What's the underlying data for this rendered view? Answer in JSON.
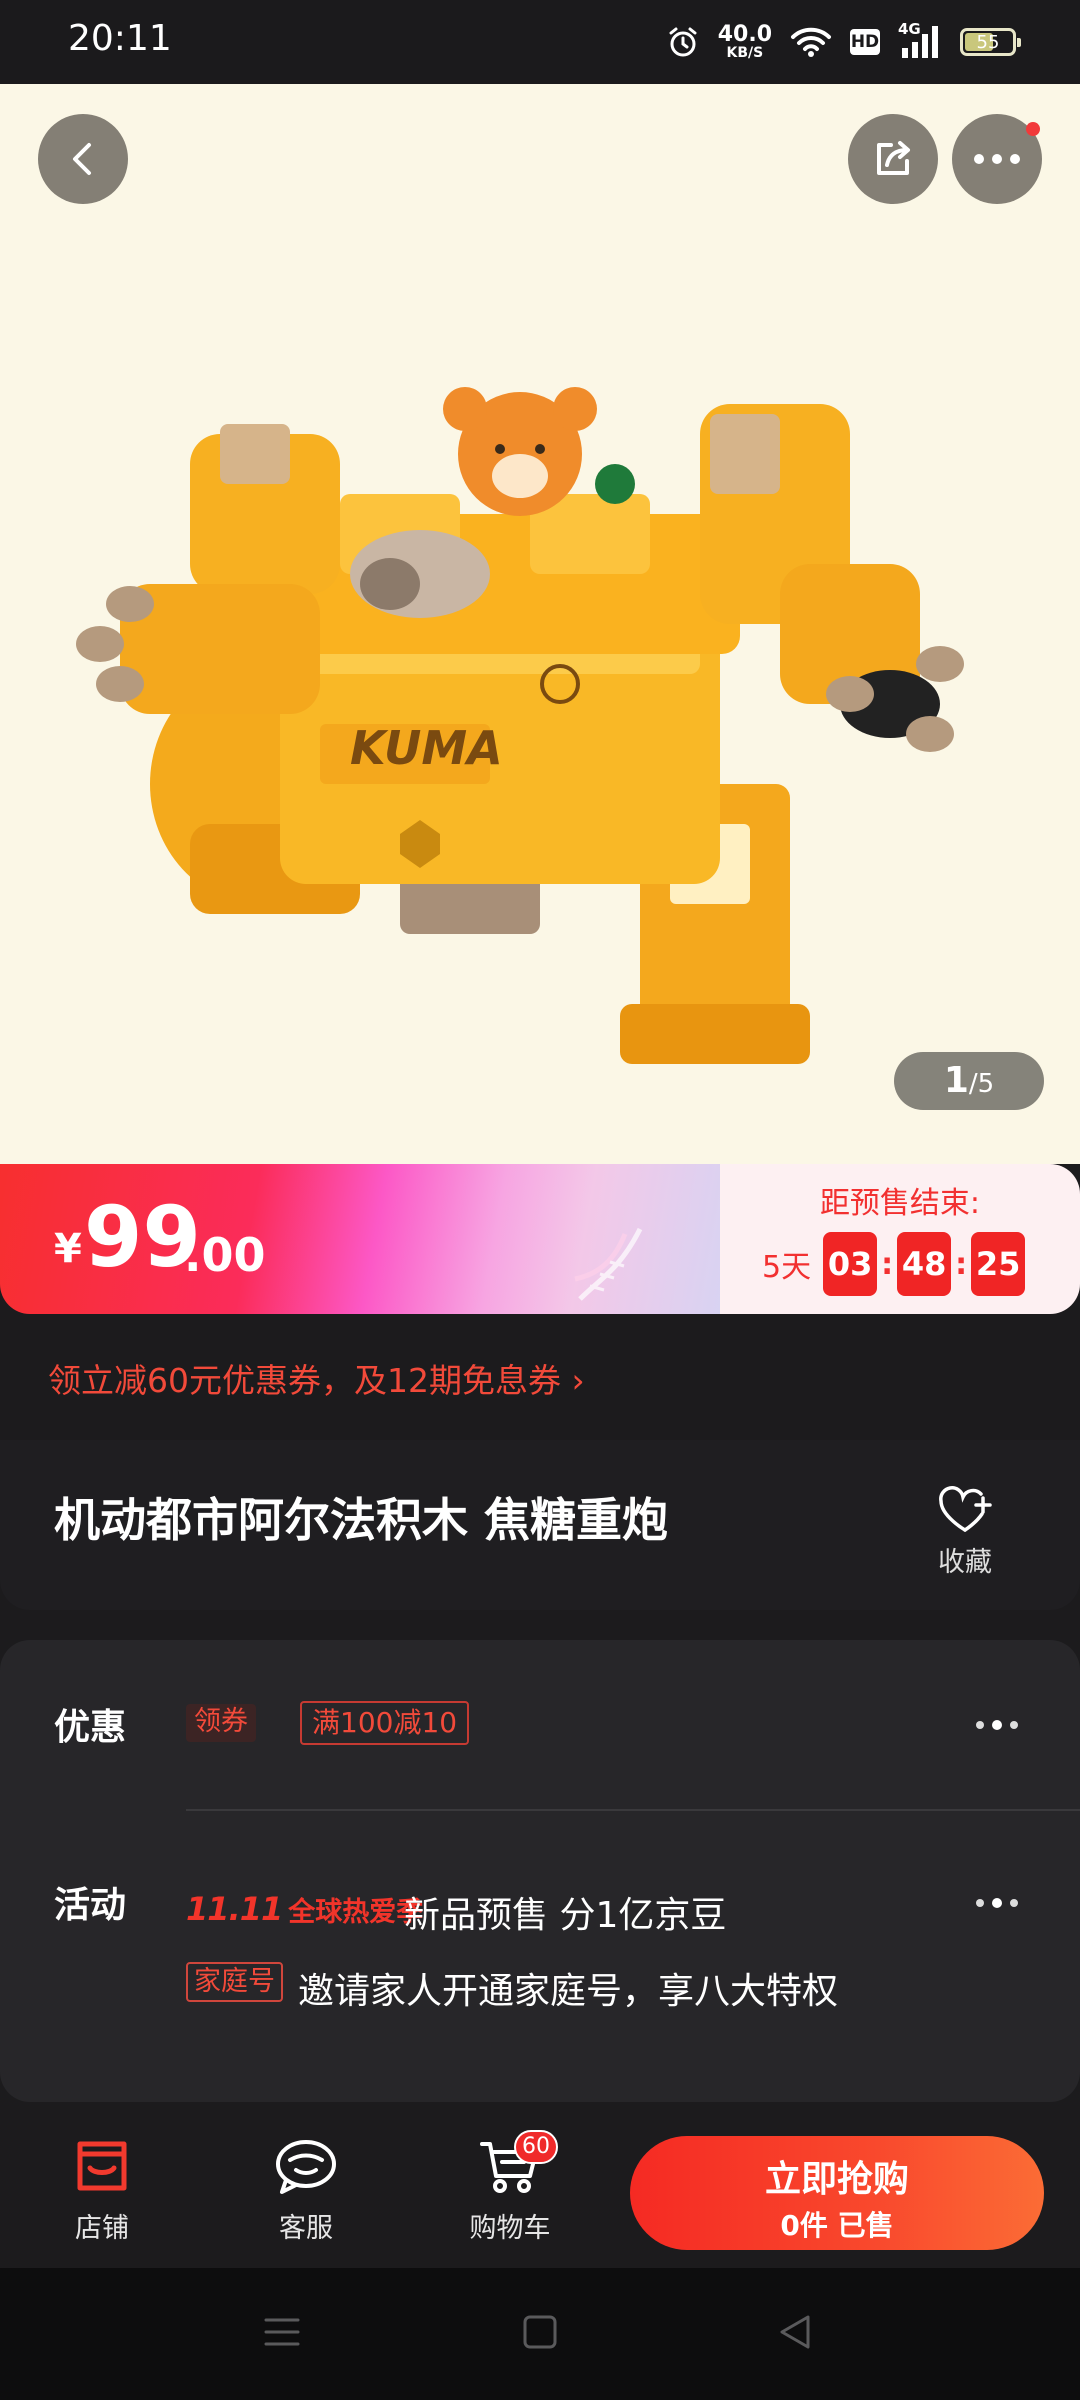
{
  "status_bar": {
    "time": "20:11",
    "net_speed_value": "40.0",
    "net_speed_unit": "KB/S",
    "hd_label": "HD",
    "network_label": "4G",
    "battery": "55"
  },
  "gallery": {
    "current_page": "1",
    "total_pages": "/5",
    "product_print": "KUMA",
    "background_color": "#fbf7e6"
  },
  "price": {
    "currency": "¥",
    "integer": "99",
    "decimal": ".00"
  },
  "presale": {
    "title": "距预售结束:",
    "days": "5天",
    "hours": "03",
    "minutes": "48",
    "seconds": "25",
    "separator": ":"
  },
  "coupon_line": "领立减60元优惠券，及12期免息券 ›",
  "product": {
    "title": "机动都市阿尔法积木 焦糖重炮",
    "favorite_label": "收藏"
  },
  "promotions": {
    "discount_label": "优惠",
    "coupon_tag": "领券",
    "coupon_offer": "满100减10",
    "activity_label": "活动",
    "event_badge_number": "11.11",
    "event_badge_text": "全球热爱季",
    "activity_text": "新品预售 分1亿京豆",
    "family_tag": "家庭号",
    "family_text": "邀请家人开通家庭号，享八大特权"
  },
  "action_bar": {
    "store_label": "店铺",
    "service_label": "客服",
    "cart_label": "购物车",
    "cart_count": "60",
    "buy_label": "立即抢购",
    "sold_label": "0件 已售"
  },
  "colors": {
    "accent_red": "#f23030",
    "background": "#1c1b1d",
    "card": "#272629"
  }
}
